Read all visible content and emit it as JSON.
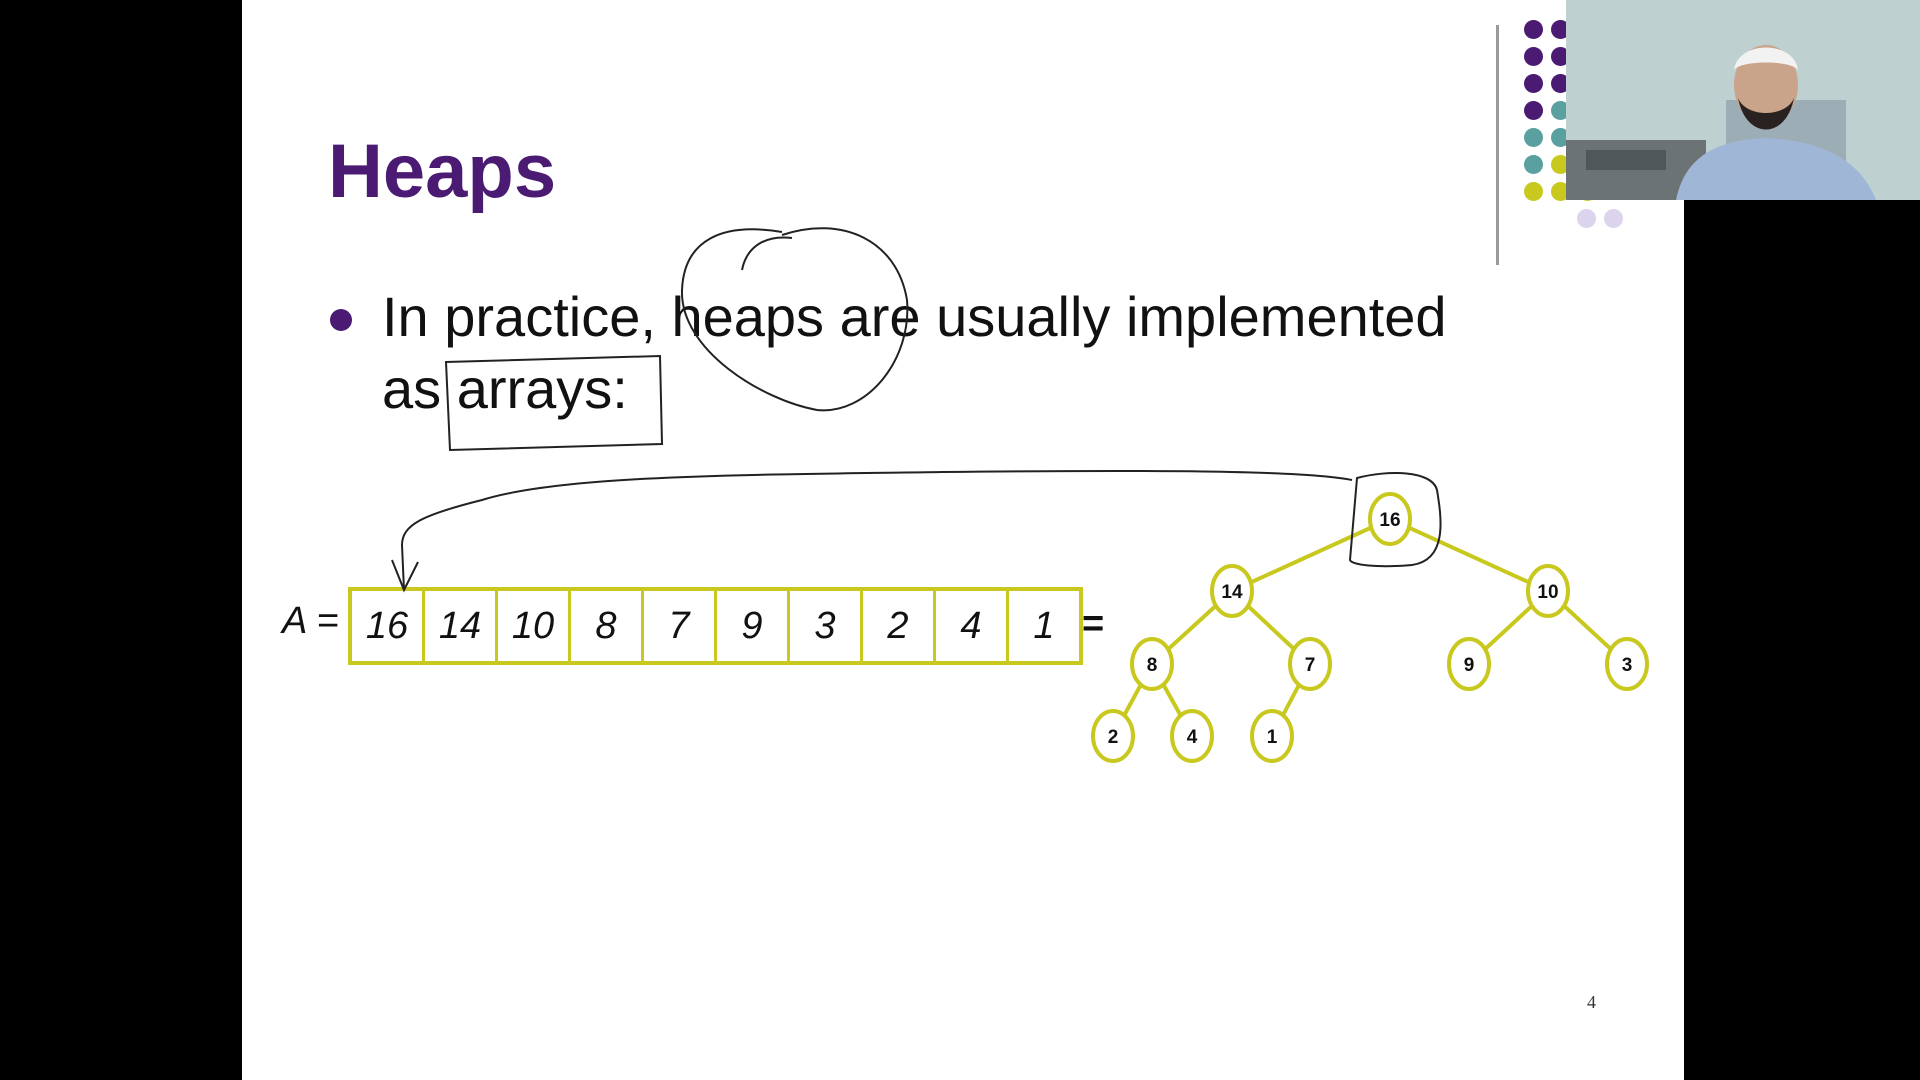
{
  "slide": {
    "title": "Heaps",
    "bullet": {
      "line1": "In practice, heaps are usually implemented",
      "line2": "as arrays:"
    },
    "array": {
      "label": "A =",
      "values": [
        "16",
        "14",
        "10",
        "8",
        "7",
        "9",
        "3",
        "2",
        "4",
        "1"
      ],
      "equals": "="
    },
    "tree": {
      "nodes": [
        "16",
        "14",
        "10",
        "8",
        "7",
        "9",
        "3",
        "2",
        "4",
        "1"
      ]
    },
    "page_number": "4"
  },
  "colors": {
    "title": "#4b1a73",
    "node_stroke": "#c8c81e",
    "dot_purple": "#4b1a73",
    "dot_teal": "#5aa0a0",
    "dot_yellow": "#c8c81e",
    "dot_lavender": "#dcd4ec"
  },
  "webcam": {
    "description_icon": "presenter-video-icon"
  }
}
